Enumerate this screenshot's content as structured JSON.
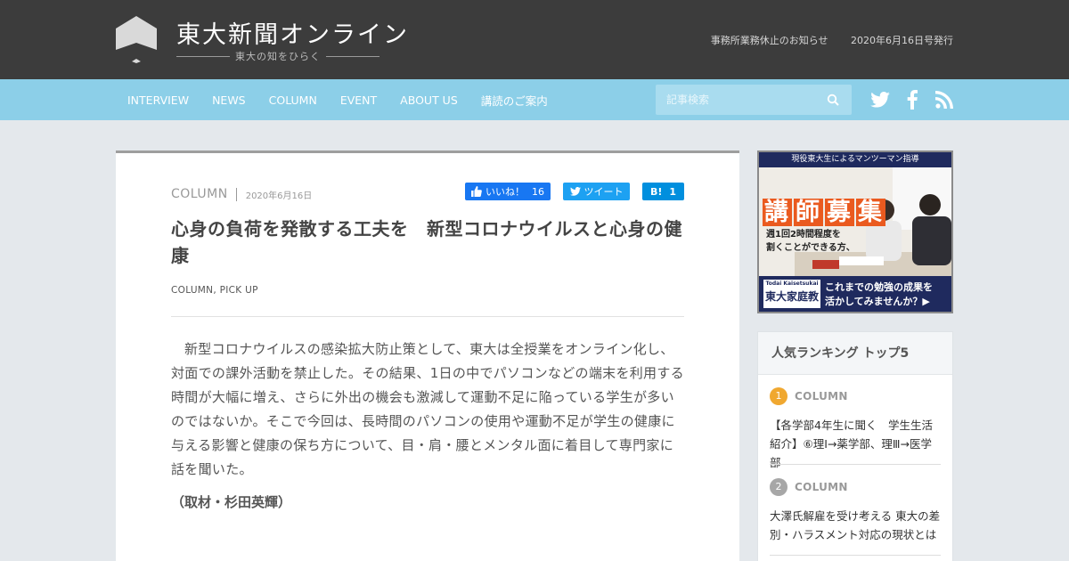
{
  "header": {
    "site_title": "東大新聞オンライン",
    "tagline": "東大の知をひらく",
    "links": [
      "事務所業務休止のお知らせ",
      "2020年6月16日号発行"
    ]
  },
  "nav": {
    "items": [
      "INTERVIEW",
      "NEWS",
      "COLUMN",
      "EVENT",
      "ABOUT US",
      "講読のご案内"
    ],
    "search_placeholder": "記事検索",
    "social_icons": [
      "twitter-icon",
      "facebook-icon",
      "rss-icon"
    ]
  },
  "article": {
    "category": "COLUMN",
    "date": "2020年6月16日",
    "share": {
      "facebook_label": "いいね！",
      "facebook_count": "16",
      "twitter_label": "ツイート",
      "hatena_label": "B!",
      "hatena_count": "1"
    },
    "title": "心身の負荷を発散する工夫を　新型コロナウイルスと心身の健康",
    "tags": "COLUMN, PICK UP",
    "body": "新型コロナウイルスの感染拡大防止策として、東大は全授業をオンライン化し、対面での課外活動を禁止した。その結果、1日の中でパソコンなどの端末を利用する時間が大幅に増え、さらに外出の機会も激減して運動不足に陥っている学生が多いのではないか。そこで今回は、長時間のパソコンの使用や運動不足が学生の健康に与える影響と健康の保ち方について、目・肩・腰とメンタル面に着目して専門家に話を聞いた。",
    "byline": "（取材・杉田英輝）"
  },
  "ad": {
    "top_text": "現役東大生によるマンツーマン指導",
    "headline": [
      "講",
      "師",
      "募",
      "集"
    ],
    "sub_line1": "週1回2時間程度を",
    "sub_line2": "割くことができる方、",
    "brand_small": "Todai Kaisetsukai",
    "brand": "東大家庭教",
    "cta_line1": "これまでの勉強の成果を",
    "cta_line2": "活かしてみませんか？▶"
  },
  "ranking": {
    "title": "人気ランキング トップ5",
    "items": [
      {
        "rank": "1",
        "category": "COLUMN",
        "title": "【各学部4年生に聞く　学生生活紹介】⑥理Ⅰ→薬学部、理Ⅲ→医学部",
        "color": "#f0a830"
      },
      {
        "rank": "2",
        "category": "COLUMN",
        "title": "大澤氏解雇を受け考える 東大の差別・ハラスメント対応の現状とは",
        "color": "#a7a7a7"
      }
    ]
  },
  "colors": {
    "header_bg": "#3c3c3c",
    "nav_bg": "#8ccfe8",
    "page_bg": "#e4e8ec"
  }
}
